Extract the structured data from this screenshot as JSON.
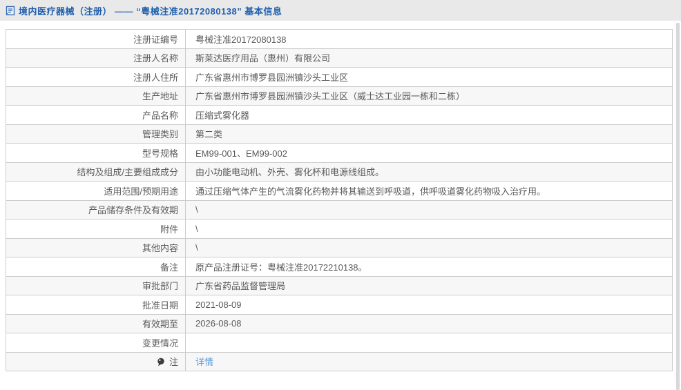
{
  "header": {
    "title": "境内医疗器械（注册） —— “粤械注准20172080138” 基本信息"
  },
  "table": {
    "rows": [
      {
        "label": "注册证编号",
        "value": "粤械注准20172080138"
      },
      {
        "label": "注册人名称",
        "value": "斯莱达医疗用品（惠州）有限公司"
      },
      {
        "label": "注册人住所",
        "value": "广东省惠州市博罗县园洲镇沙头工业区"
      },
      {
        "label": "生产地址",
        "value": "广东省惠州市博罗县园洲镇沙头工业区（威士达工业园一栋和二栋）"
      },
      {
        "label": "产品名称",
        "value": "压缩式雾化器"
      },
      {
        "label": "管理类别",
        "value": "第二类"
      },
      {
        "label": "型号规格",
        "value": "EM99-001、EM99-002"
      },
      {
        "label": "结构及组成/主要组成成分",
        "value": "由小功能电动机、外壳、雾化杯和电源线组成。"
      },
      {
        "label": "适用范围/预期用途",
        "value": "通过压缩气体产生的气流雾化药物并将其输送到呼吸道，供呼吸道雾化药物吸入治疗用。"
      },
      {
        "label": "产品储存条件及有效期",
        "value": "\\"
      },
      {
        "label": "附件",
        "value": "\\"
      },
      {
        "label": "其他内容",
        "value": "\\"
      },
      {
        "label": "备注",
        "value": "原产品注册证号：粤械注准20172210138。"
      },
      {
        "label": "审批部门",
        "value": "广东省药品监督管理局"
      },
      {
        "label": "批准日期",
        "value": "2021-08-09"
      },
      {
        "label": "有效期至",
        "value": "2026-08-08"
      },
      {
        "label": "变更情况",
        "value": ""
      },
      {
        "label": "注",
        "value": "详情",
        "value_type": "link",
        "label_icon": "balloon-icon"
      }
    ]
  },
  "icons": {
    "header_icon": "document-icon",
    "note_row_icon": "balloon-icon"
  },
  "colors": {
    "title_blue": "#1f5fae",
    "link_blue": "#5b9dd9",
    "header_bg": "#e9e9e9",
    "row_alt_bg": "#f7f7f7",
    "border": "#cccccc"
  }
}
